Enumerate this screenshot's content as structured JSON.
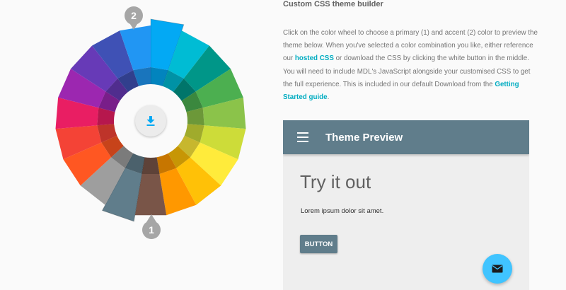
{
  "builder": {
    "title": "Custom CSS theme builder",
    "desc_part1": "Click on the color wheel to choose a primary (1) and accent (2) color to preview the theme below. When you've selected a color combination you like, either reference our ",
    "hosted_css_link": "hosted CSS",
    "desc_part2": " or download the CSS by clicking the white button in the middle. You will need to include MDL's JavaScript alongside your customised CSS to get the full experience. This is included in our default Download from the ",
    "getting_started_link": "Getting Started guide",
    "desc_part3": "."
  },
  "wheel": {
    "colors": [
      "#03a9f4",
      "#00bcd4",
      "#009688",
      "#4caf50",
      "#8bc34a",
      "#cddc39",
      "#ffeb3b",
      "#ffc107",
      "#ff9800",
      "#795548",
      "#607d8b",
      "#9e9e9e",
      "#ff5722",
      "#f44336",
      "#e91e63",
      "#9c27b0",
      "#673ab7",
      "#3f51b5",
      "#2196f3"
    ],
    "primary": "#607d8b",
    "accent": "#03a9f4",
    "primary_label": "1",
    "accent_label": "2",
    "download_icon": "download-icon"
  },
  "preview": {
    "title": "Theme Preview",
    "heading": "Try it out",
    "text": "Lorem ipsum dolor sit amet.",
    "button_label": "BUTTON",
    "menu_icon": "hamburger-menu-icon",
    "fab_icon": "email-icon",
    "header_color": "#607d8b",
    "fab_color": "#40c4ff"
  }
}
